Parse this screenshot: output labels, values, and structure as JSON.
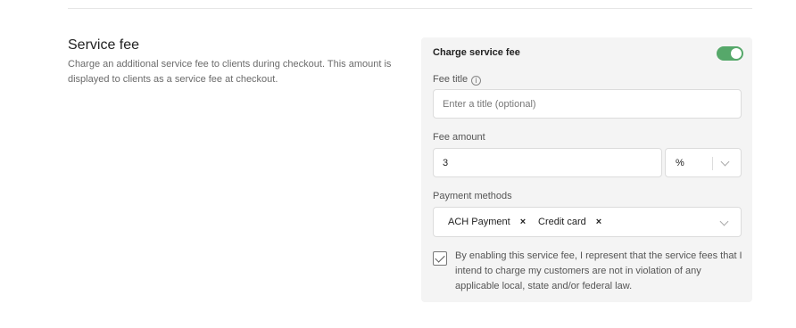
{
  "section": {
    "title": "Service fee",
    "description": "Charge an additional service fee to clients during checkout. This amount is displayed to clients as a service fee at checkout."
  },
  "panel": {
    "charge_label": "Charge service fee",
    "charge_enabled": true,
    "fee_title": {
      "label": "Fee title",
      "placeholder": "Enter a title (optional)",
      "value": ""
    },
    "fee_amount": {
      "label": "Fee amount",
      "value": "3",
      "unit": "%"
    },
    "payment_methods": {
      "label": "Payment methods",
      "selected": [
        "ACH Payment",
        "Credit card"
      ],
      "remove_glyph": "×"
    },
    "consent": {
      "checked": true,
      "text": "By enabling this service fee, I represent that the service fees that I intend to charge my customers are not in violation of any applicable local, state and/or federal law."
    }
  },
  "colors": {
    "toggle_on": "#56a86a",
    "panel_bg": "#f4f4f4"
  }
}
